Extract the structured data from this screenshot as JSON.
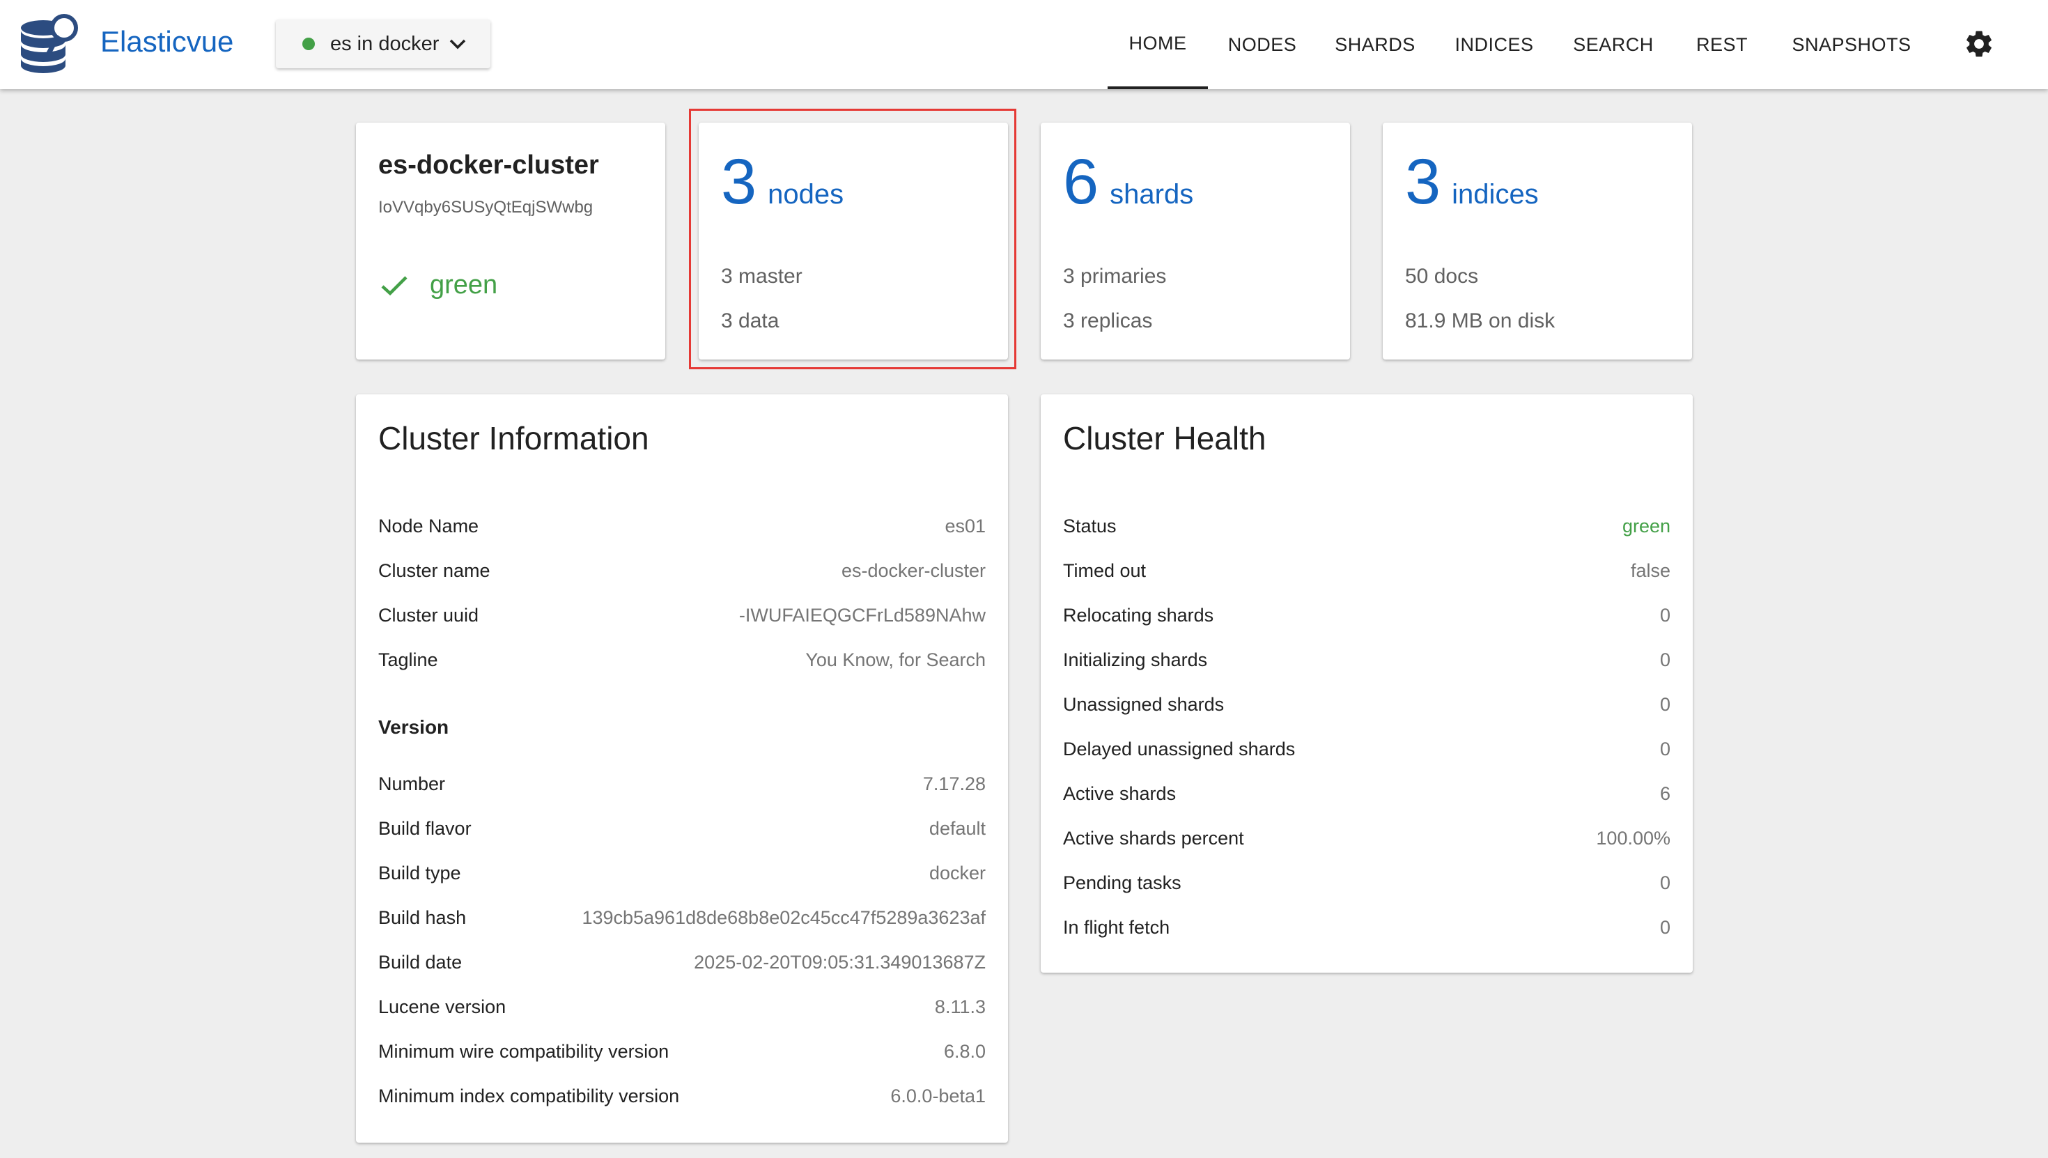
{
  "header": {
    "brand": "Elasticvue",
    "cluster_selector": {
      "label": "es in docker",
      "status_color": "#43a047"
    },
    "nav": [
      {
        "label": "HOME",
        "active": true
      },
      {
        "label": "NODES"
      },
      {
        "label": "SHARDS"
      },
      {
        "label": "INDICES"
      },
      {
        "label": "SEARCH"
      },
      {
        "label": "REST"
      },
      {
        "label": "SNAPSHOTS"
      }
    ],
    "settings_icon": "gear-icon"
  },
  "colors": {
    "accent": "#1565c0",
    "green": "#43a047",
    "highlight": "#e53935"
  },
  "summary": {
    "cluster": {
      "name": "es-docker-cluster",
      "uuid": "IoVVqby6SUSyQtEqjSWwbg",
      "status": "green",
      "status_icon": "check-icon"
    },
    "nodes": {
      "count": "3",
      "unit": "nodes",
      "line1": "3 master",
      "line2": "3 data"
    },
    "shards": {
      "count": "6",
      "unit": "shards",
      "line1": "3 primaries",
      "line2": "3 replicas"
    },
    "indices": {
      "count": "3",
      "unit": "indices",
      "line1": "50 docs",
      "line2": "81.9 MB on disk"
    }
  },
  "cluster_info": {
    "title": "Cluster Information",
    "rows": [
      {
        "k": "Node Name",
        "v": "es01"
      },
      {
        "k": "Cluster name",
        "v": "es-docker-cluster"
      },
      {
        "k": "Cluster uuid",
        "v": "-IWUFAIEQGCFrLd589NAhw"
      },
      {
        "k": "Tagline",
        "v": "You Know, for Search"
      }
    ],
    "version_heading": "Version",
    "version_rows": [
      {
        "k": "Number",
        "v": "7.17.28"
      },
      {
        "k": "Build flavor",
        "v": "default"
      },
      {
        "k": "Build type",
        "v": "docker"
      },
      {
        "k": "Build hash",
        "v": "139cb5a961d8de68b8e02c45cc47f5289a3623af"
      },
      {
        "k": "Build date",
        "v": "2025-02-20T09:05:31.349013687Z"
      },
      {
        "k": "Lucene version",
        "v": "8.11.3"
      },
      {
        "k": "Minimum wire compatibility version",
        "v": "6.8.0"
      },
      {
        "k": "Minimum index compatibility version",
        "v": "6.0.0-beta1"
      }
    ]
  },
  "cluster_health": {
    "title": "Cluster Health",
    "rows": [
      {
        "k": "Status",
        "v": "green"
      },
      {
        "k": "Timed out",
        "v": "false"
      },
      {
        "k": "Relocating shards",
        "v": "0"
      },
      {
        "k": "Initializing shards",
        "v": "0"
      },
      {
        "k": "Unassigned shards",
        "v": "0"
      },
      {
        "k": "Delayed unassigned shards",
        "v": "0"
      },
      {
        "k": "Active shards",
        "v": "6"
      },
      {
        "k": "Active shards percent",
        "v": "100.00%"
      },
      {
        "k": "Pending tasks",
        "v": "0"
      },
      {
        "k": "In flight fetch",
        "v": "0"
      }
    ]
  }
}
